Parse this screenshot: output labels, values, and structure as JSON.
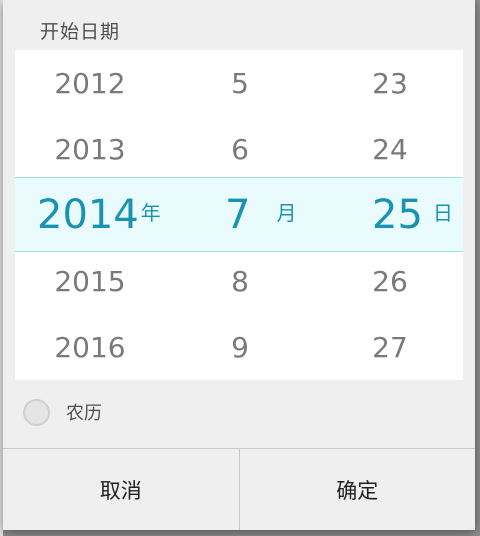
{
  "dialog": {
    "title": "开始日期",
    "lunar_label": "农历",
    "lunar_checked": false,
    "cancel_label": "取消",
    "confirm_label": "确定"
  },
  "picker": {
    "year": {
      "above": [
        "2012",
        "2013"
      ],
      "selected": "2014",
      "unit": "年",
      "below": [
        "2015",
        "2016"
      ]
    },
    "month": {
      "above": [
        "5",
        "6"
      ],
      "selected": "7",
      "unit": "月",
      "below": [
        "8",
        "9"
      ]
    },
    "day": {
      "above": [
        "23",
        "24"
      ],
      "selected": "25",
      "unit": "日",
      "below": [
        "26",
        "27"
      ]
    }
  },
  "colors": {
    "accent": "#1a93b2",
    "highlight_bg": "#e9fbfd",
    "dialog_bg": "#efefef"
  }
}
